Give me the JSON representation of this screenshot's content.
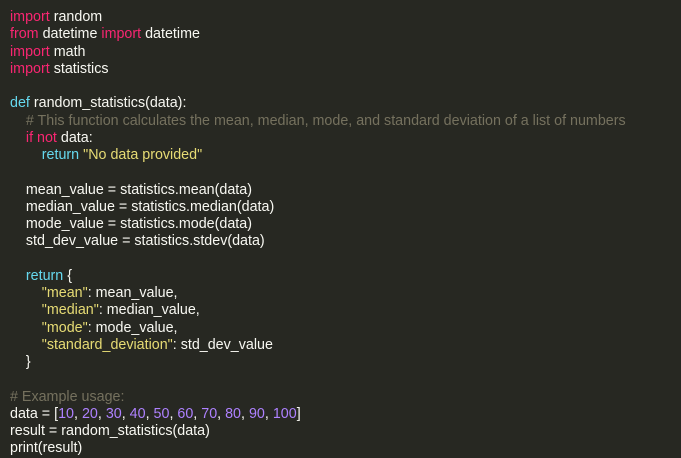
{
  "editor": {
    "lines": [
      [
        {
          "t": "import",
          "c": "kw"
        },
        {
          "t": " random",
          "c": "op"
        }
      ],
      [
        {
          "t": "from",
          "c": "kw"
        },
        {
          "t": " datetime ",
          "c": "op"
        },
        {
          "t": "import",
          "c": "kw"
        },
        {
          "t": " datetime",
          "c": "op"
        }
      ],
      [
        {
          "t": "import",
          "c": "kw"
        },
        {
          "t": " math",
          "c": "op"
        }
      ],
      [
        {
          "t": "import",
          "c": "kw"
        },
        {
          "t": " statistics",
          "c": "op"
        }
      ],
      [],
      [
        {
          "t": "def ",
          "c": "fn"
        },
        {
          "t": "random_statistics(data):",
          "c": "op"
        }
      ],
      [
        {
          "t": "    ",
          "c": "op"
        },
        {
          "t": "# This function calculates the mean, median, mode, and standard deviation of a list of numbers",
          "c": "cm"
        }
      ],
      [
        {
          "t": "    ",
          "c": "op"
        },
        {
          "t": "if",
          "c": "kw"
        },
        {
          "t": " ",
          "c": "op"
        },
        {
          "t": "not",
          "c": "kw"
        },
        {
          "t": " data:",
          "c": "op"
        }
      ],
      [
        {
          "t": "        ",
          "c": "op"
        },
        {
          "t": "return",
          "c": "fn"
        },
        {
          "t": " ",
          "c": "op"
        },
        {
          "t": "\"No data provided\"",
          "c": "str"
        }
      ],
      [],
      [
        {
          "t": "    mean_value = statistics.mean(data)",
          "c": "op"
        }
      ],
      [
        {
          "t": "    median_value = statistics.median(data)",
          "c": "op"
        }
      ],
      [
        {
          "t": "    mode_value = statistics.mode(data)",
          "c": "op"
        }
      ],
      [
        {
          "t": "    std_dev_value = statistics.stdev(data)",
          "c": "op"
        }
      ],
      [],
      [
        {
          "t": "    ",
          "c": "op"
        },
        {
          "t": "return",
          "c": "fn"
        },
        {
          "t": " {",
          "c": "op"
        }
      ],
      [
        {
          "t": "        ",
          "c": "op"
        },
        {
          "t": "\"mean\"",
          "c": "str"
        },
        {
          "t": ": mean_value,",
          "c": "op"
        }
      ],
      [
        {
          "t": "        ",
          "c": "op"
        },
        {
          "t": "\"median\"",
          "c": "str"
        },
        {
          "t": ": median_value,",
          "c": "op"
        }
      ],
      [
        {
          "t": "        ",
          "c": "op"
        },
        {
          "t": "\"mode\"",
          "c": "str"
        },
        {
          "t": ": mode_value,",
          "c": "op"
        }
      ],
      [
        {
          "t": "        ",
          "c": "op"
        },
        {
          "t": "\"standard_deviation\"",
          "c": "str"
        },
        {
          "t": ": std_dev_value",
          "c": "op"
        }
      ],
      [
        {
          "t": "    }",
          "c": "op"
        }
      ],
      [],
      [
        {
          "t": "# Example usage:",
          "c": "cm"
        }
      ],
      [
        {
          "t": "data = [",
          "c": "op"
        },
        {
          "t": "10",
          "c": "num"
        },
        {
          "t": ", ",
          "c": "op"
        },
        {
          "t": "20",
          "c": "num"
        },
        {
          "t": ", ",
          "c": "op"
        },
        {
          "t": "30",
          "c": "num"
        },
        {
          "t": ", ",
          "c": "op"
        },
        {
          "t": "40",
          "c": "num"
        },
        {
          "t": ", ",
          "c": "op"
        },
        {
          "t": "50",
          "c": "num"
        },
        {
          "t": ", ",
          "c": "op"
        },
        {
          "t": "60",
          "c": "num"
        },
        {
          "t": ", ",
          "c": "op"
        },
        {
          "t": "70",
          "c": "num"
        },
        {
          "t": ", ",
          "c": "op"
        },
        {
          "t": "80",
          "c": "num"
        },
        {
          "t": ", ",
          "c": "op"
        },
        {
          "t": "90",
          "c": "num"
        },
        {
          "t": ", ",
          "c": "op"
        },
        {
          "t": "100",
          "c": "num"
        },
        {
          "t": "]",
          "c": "op"
        }
      ],
      [
        {
          "t": "result = random_statistics(data)",
          "c": "op"
        }
      ],
      [
        {
          "t": "print(result)",
          "c": "op"
        }
      ]
    ]
  },
  "colors": {
    "background": "#272822",
    "text": "#f8f8f2",
    "keyword": "#f92672",
    "builtin": "#66d9ef",
    "string": "#e6db74",
    "number": "#ae81ff",
    "comment": "#75715e"
  }
}
